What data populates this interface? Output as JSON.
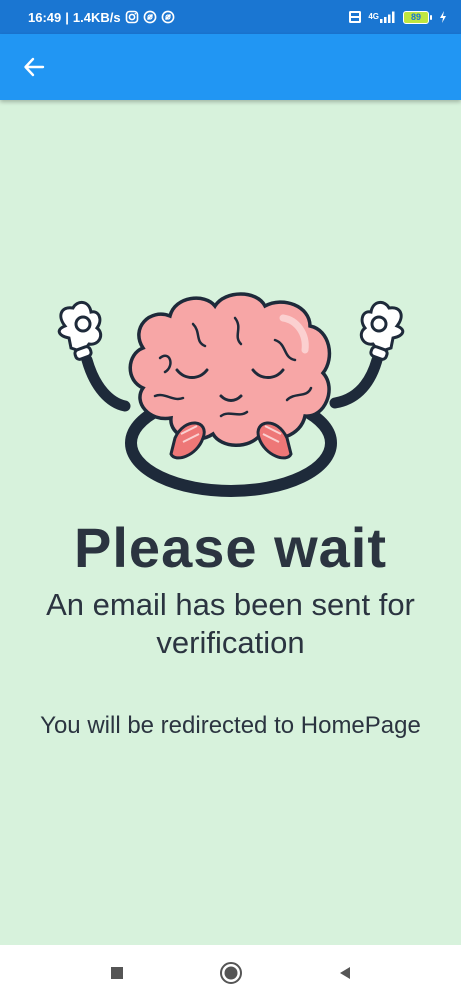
{
  "status_bar": {
    "time": "16:49",
    "speed": "1.4KB/s",
    "network_label": "4G",
    "battery": "89",
    "icons": [
      "instagram-icon",
      "notification-icon",
      "notification-icon",
      "volte-icon",
      "signal-icon",
      "battery-icon",
      "charging-icon"
    ]
  },
  "app_bar": {
    "back_icon": "arrow-left-icon",
    "color": "#2196f3"
  },
  "main": {
    "illustration": "meditating-brain",
    "title": "Please wait",
    "subtitle": "An email has been sent for verification",
    "redirect_message": "You will be redirected to HomePage",
    "background": "#d7f2dc"
  },
  "nav_bar": {
    "buttons": [
      "recents-square-icon",
      "home-circle-icon",
      "back-triangle-icon"
    ]
  }
}
